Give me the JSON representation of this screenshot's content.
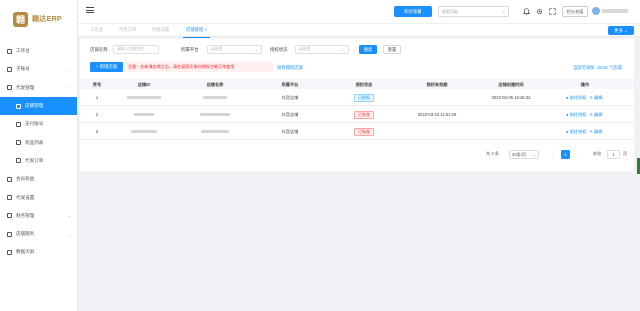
{
  "logo": {
    "text": "翱达ERP",
    "mark": "翱"
  },
  "sidebar": {
    "items": [
      {
        "label": "工作台",
        "icon": "desktop-icon",
        "sub": false,
        "arrow": ""
      },
      {
        "label": "子账号",
        "icon": "user-icon",
        "sub": false,
        "arrow": "⌄"
      },
      {
        "label": "代发管理",
        "icon": "package-icon",
        "sub": false,
        "arrow": "⌃"
      },
      {
        "label": "店铺管理",
        "icon": "shop-icon",
        "sub": true,
        "active": true,
        "arrow": ""
      },
      {
        "label": "支付账号",
        "icon": "wallet-icon",
        "sub": true,
        "arrow": ""
      },
      {
        "label": "商品列表",
        "icon": "goods-icon",
        "sub": true,
        "arrow": ""
      },
      {
        "label": "代发订单",
        "icon": "order-icon",
        "sub": true,
        "arrow": ""
      },
      {
        "label": "会员权益",
        "icon": "vip-icon",
        "sub": false,
        "arrow": ""
      },
      {
        "label": "代发设置",
        "icon": "settings-icon",
        "sub": false,
        "arrow": ""
      },
      {
        "label": "财务管理",
        "icon": "finance-icon",
        "sub": false,
        "arrow": "⌄"
      },
      {
        "label": "店铺服务",
        "icon": "service-icon",
        "sub": false,
        "arrow": "⌄"
      },
      {
        "label": "数据大屏",
        "icon": "screen-icon",
        "sub": false,
        "arrow": ""
      }
    ]
  },
  "topbar": {
    "primary_button": "购买套餐",
    "search_placeholder": "搜索功能",
    "search_icon": "⌕",
    "account_button": "积分充值",
    "icons": [
      "bell-icon",
      "gear-icon",
      "fullscreen-icon"
    ]
  },
  "tabs": [
    {
      "label": "工作台",
      "active": false
    },
    {
      "label": "代发订单",
      "active": false
    },
    {
      "label": "代发设置",
      "active": false
    },
    {
      "label": "店铺管理",
      "active": true
    }
  ],
  "more_button": "更多",
  "filters": {
    "shop_name_label": "店铺名称",
    "shop_name_placeholder": "请输入店铺名称",
    "platform_label": "所属平台",
    "platform_placeholder": "请选择",
    "auth_label": "授权状态",
    "auth_placeholder": "请选择",
    "search_button": "搜索",
    "reset_button": "重置"
  },
  "toolbar": {
    "add_button": "+ 新增店铺",
    "notice": "注意：在新增店铺之后，请在爱奇乐接口授权才能正常使用",
    "auth_link": "如何授权店铺",
    "usage_link": "当前可添加: 15/15 个店铺"
  },
  "table": {
    "headers": [
      "序号",
      "店铺ID",
      "店铺名称",
      "所属平台",
      "授权状态",
      "授权有效期",
      "店铺创建时间",
      "操作"
    ],
    "rows": [
      {
        "index": "1",
        "platform": "抖音店铺",
        "status": "已授权",
        "status_type": "ok",
        "expiry": "",
        "created": "2023-02-05 16:46:32"
      },
      {
        "index": "2",
        "platform": "抖音店铺",
        "status": "已失效",
        "status_type": "bad",
        "expiry": "2022-03-23 11:51:29",
        "created": ""
      },
      {
        "index": "3",
        "platform": "抖音店铺",
        "status": "已失效",
        "status_type": "bad",
        "expiry": "",
        "created": ""
      }
    ],
    "op_auth": "● 前往授权",
    "op_edit": "✎ 编辑"
  },
  "pagination": {
    "total": "共 3 条",
    "page_size": "20条/页",
    "prev": "‹",
    "current": "1",
    "next": "›",
    "goto_label": "前往",
    "goto_value": "1",
    "page_unit": "页"
  },
  "colors": {
    "accent": "#1890ff",
    "danger": "#f5222d",
    "brand": "#b7893f"
  }
}
